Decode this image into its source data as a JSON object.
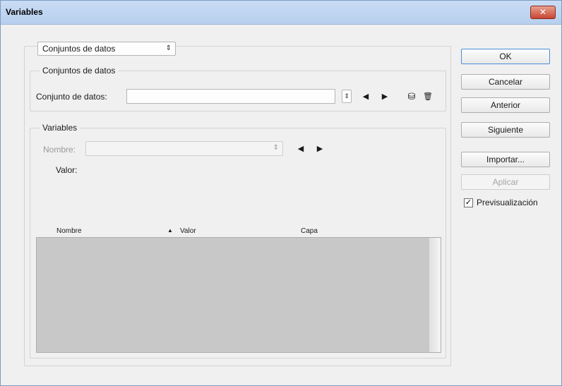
{
  "window": {
    "title": "Variables",
    "close_glyph": "✕"
  },
  "top_dropdown": {
    "value": "Conjuntos de datos",
    "arrow": "⇕"
  },
  "datasets_group": {
    "legend": "Conjuntos de datos",
    "dataset_label": "Conjunto de datos:",
    "dataset_value": "",
    "spin_glyph": "⇕",
    "prev_glyph": "◀",
    "next_glyph": "▶",
    "save_icon": "save-dataset-icon",
    "save_glyph": "⛁",
    "delete_icon": "trash-icon",
    "delete_glyph": "🗑"
  },
  "variables_group": {
    "legend": "Variables",
    "name_label": "Nombre:",
    "name_value": "",
    "name_arrow": "⇕",
    "prev_glyph": "◀",
    "next_glyph": "▶",
    "value_label": "Valor:",
    "columns": [
      "Nombre",
      "Valor",
      "Capa"
    ],
    "sort_glyph": "▲"
  },
  "buttons": {
    "ok": "OK",
    "cancel": "Cancelar",
    "previous": "Anterior",
    "next": "Siguiente",
    "import": "Importar...",
    "apply": "Aplicar"
  },
  "preview": {
    "label": "Previsualización",
    "checked": true,
    "check_glyph": "✓"
  }
}
